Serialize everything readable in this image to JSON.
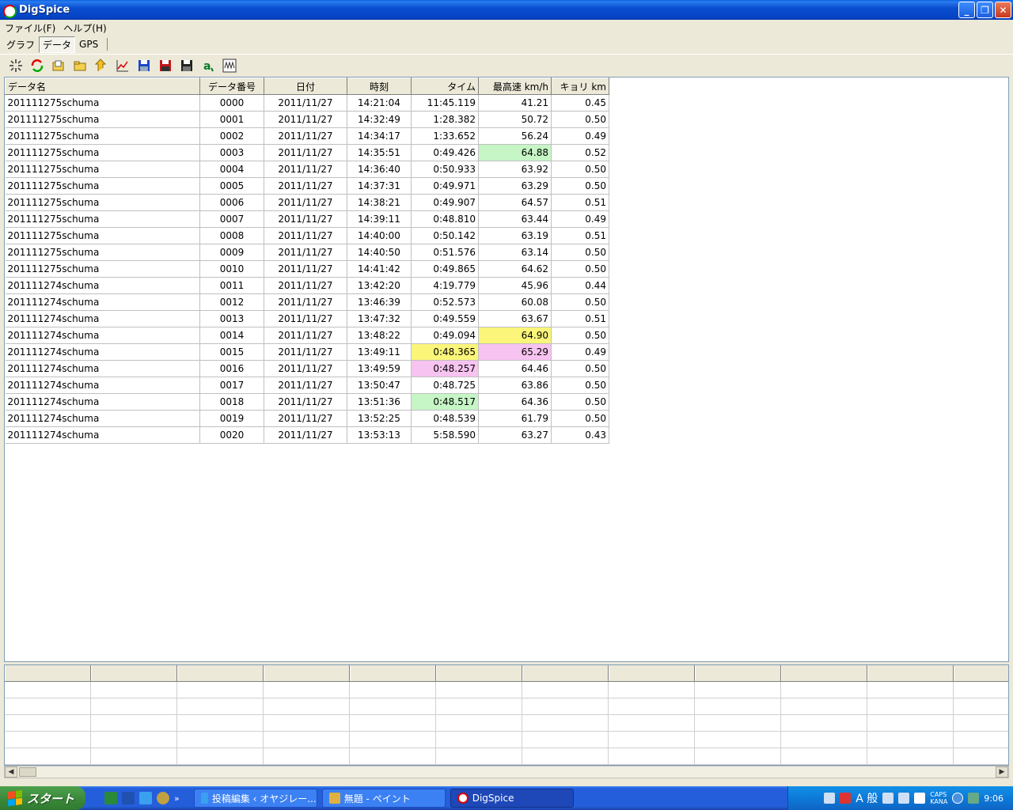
{
  "window": {
    "title": "DigSpice"
  },
  "menu": {
    "items": [
      "ファイル(F)",
      "ヘルプ(H)"
    ]
  },
  "tabs": [
    {
      "label": "グラフ",
      "active": false
    },
    {
      "label": "データ",
      "active": true
    },
    {
      "label": "GPS",
      "active": false
    }
  ],
  "toolbar": {
    "icons": [
      "sparkle-icon",
      "refresh-icon",
      "folder-open-icon",
      "folder-icon",
      "up-arrow-icon",
      "line-chart-icon",
      "save-blue-icon",
      "save-red-icon",
      "save-black-icon",
      "text-a-icon",
      "waveform-icon"
    ]
  },
  "table": {
    "headers": [
      "データ名",
      "データ番号",
      "日付",
      "時刻",
      "タイム",
      "最高速 km/h",
      "キョリ km"
    ],
    "rows": [
      [
        "201111275schuma",
        "0000",
        "2011/11/27",
        "14:21:04",
        "11:45.119",
        "41.21",
        "0.45"
      ],
      [
        "201111275schuma",
        "0001",
        "2011/11/27",
        "14:32:49",
        "1:28.382",
        "50.72",
        "0.50"
      ],
      [
        "201111275schuma",
        "0002",
        "2011/11/27",
        "14:34:17",
        "1:33.652",
        "56.24",
        "0.49"
      ],
      [
        "201111275schuma",
        "0003",
        "2011/11/27",
        "14:35:51",
        "0:49.426",
        "64.88",
        "0.52"
      ],
      [
        "201111275schuma",
        "0004",
        "2011/11/27",
        "14:36:40",
        "0:50.933",
        "63.92",
        "0.50"
      ],
      [
        "201111275schuma",
        "0005",
        "2011/11/27",
        "14:37:31",
        "0:49.971",
        "63.29",
        "0.50"
      ],
      [
        "201111275schuma",
        "0006",
        "2011/11/27",
        "14:38:21",
        "0:49.907",
        "64.57",
        "0.51"
      ],
      [
        "201111275schuma",
        "0007",
        "2011/11/27",
        "14:39:11",
        "0:48.810",
        "63.44",
        "0.49"
      ],
      [
        "201111275schuma",
        "0008",
        "2011/11/27",
        "14:40:00",
        "0:50.142",
        "63.19",
        "0.51"
      ],
      [
        "201111275schuma",
        "0009",
        "2011/11/27",
        "14:40:50",
        "0:51.576",
        "63.14",
        "0.50"
      ],
      [
        "201111275schuma",
        "0010",
        "2011/11/27",
        "14:41:42",
        "0:49.865",
        "64.62",
        "0.50"
      ],
      [
        "201111274schuma",
        "0011",
        "2011/11/27",
        "13:42:20",
        "4:19.779",
        "45.96",
        "0.44"
      ],
      [
        "201111274schuma",
        "0012",
        "2011/11/27",
        "13:46:39",
        "0:52.573",
        "60.08",
        "0.50"
      ],
      [
        "201111274schuma",
        "0013",
        "2011/11/27",
        "13:47:32",
        "0:49.559",
        "63.67",
        "0.51"
      ],
      [
        "201111274schuma",
        "0014",
        "2011/11/27",
        "13:48:22",
        "0:49.094",
        "64.90",
        "0.50"
      ],
      [
        "201111274schuma",
        "0015",
        "2011/11/27",
        "13:49:11",
        "0:48.365",
        "65.29",
        "0.49"
      ],
      [
        "201111274schuma",
        "0016",
        "2011/11/27",
        "13:49:59",
        "0:48.257",
        "64.46",
        "0.50"
      ],
      [
        "201111274schuma",
        "0017",
        "2011/11/27",
        "13:50:47",
        "0:48.725",
        "63.86",
        "0.50"
      ],
      [
        "201111274schuma",
        "0018",
        "2011/11/27",
        "13:51:36",
        "0:48.517",
        "64.36",
        "0.50"
      ],
      [
        "201111274schuma",
        "0019",
        "2011/11/27",
        "13:52:25",
        "0:48.539",
        "61.79",
        "0.50"
      ],
      [
        "201111274schuma",
        "0020",
        "2011/11/27",
        "13:53:13",
        "5:58.590",
        "63.27",
        "0.43"
      ]
    ],
    "highlights": [
      {
        "row": 3,
        "col": 5,
        "color": "green"
      },
      {
        "row": 14,
        "col": 5,
        "color": "yellow"
      },
      {
        "row": 15,
        "col": 4,
        "color": "yellow"
      },
      {
        "row": 15,
        "col": 5,
        "color": "pink"
      },
      {
        "row": 16,
        "col": 4,
        "color": "pink"
      },
      {
        "row": 18,
        "col": 4,
        "color": "green"
      }
    ]
  },
  "colors": {
    "green": "#c6f5c6",
    "yellow": "#fbf57a",
    "pink": "#f7c3f0",
    "titlebar": "#0a4fd0"
  },
  "taskbar": {
    "start_label": "スタート",
    "tasks": [
      {
        "label": "投稿編集 ‹ オヤジレー...",
        "active": false
      },
      {
        "label": "無題 - ペイント",
        "active": false
      },
      {
        "label": "DigSpice",
        "active": true
      }
    ],
    "tray_ime": "A 般",
    "tray_caps": "CAPS",
    "tray_kana": "KANA",
    "clock": "9:06"
  }
}
